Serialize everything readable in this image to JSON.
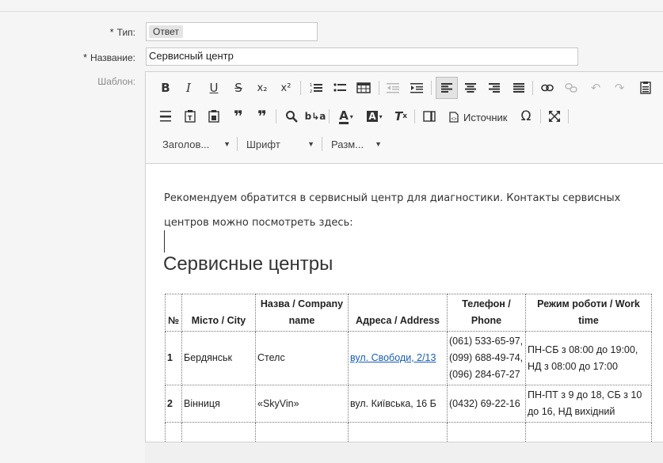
{
  "form": {
    "type_label": "Тип:",
    "type_value": "Ответ",
    "name_label": "Название:",
    "name_value": "Сервисный центр",
    "template_label": "Шаблон:",
    "required_mark": "*"
  },
  "toolbar": {
    "source_label": "Источник",
    "heading_combo": "Заголов...",
    "font_combo": "Шрифт",
    "size_combo": "Разм...",
    "icons": [
      "bold-icon",
      "italic-icon",
      "underline-icon",
      "strikethrough-icon",
      "subscript-icon",
      "superscript-icon",
      "numbered-list-icon",
      "bulleted-list-icon",
      "table-icon",
      "outdent-icon",
      "indent-icon",
      "align-left-icon",
      "align-center-icon",
      "align-right-icon",
      "justify-icon",
      "link-icon",
      "unlink-icon",
      "undo-icon",
      "redo-icon",
      "paste-icon",
      "horizontal-rule-icon",
      "paste-text-icon",
      "paste-word-icon",
      "blockquote-icon",
      "quote-icon",
      "find-icon",
      "replace-icon",
      "text-color-icon",
      "bg-color-icon",
      "remove-format-icon",
      "templates-icon",
      "source-icon",
      "special-char-icon",
      "maximize-icon"
    ]
  },
  "content": {
    "paragraph": "Рекомендуем обратится в сервисный центр для диагностики. Контакты сервисных центров можно посмотреть здесь:",
    "heading": "Сервисные центры",
    "table": {
      "headers": [
        "№",
        "Місто / City",
        "Назва / Company name",
        "Адреса / Address",
        "Телефон / Phone",
        "Режим роботи / Work time"
      ],
      "rows": [
        [
          "1",
          "Бердянськ",
          "Стелс",
          "вул. Свободи, 2/13",
          "(061) 533-65-97, (099) 688-49-74, (096) 284-67-27",
          "ПН-СБ з 08:00 до 19:00, НД з 08:00 до 17:00"
        ],
        [
          "2",
          "Вінниця",
          "«SkyVin»",
          "вул. Київська, 16 Б",
          "(0432) 69-22-16",
          "ПН-ПТ з 9 до 18, СБ з 10 до 16, НД вихідний"
        ]
      ]
    }
  }
}
